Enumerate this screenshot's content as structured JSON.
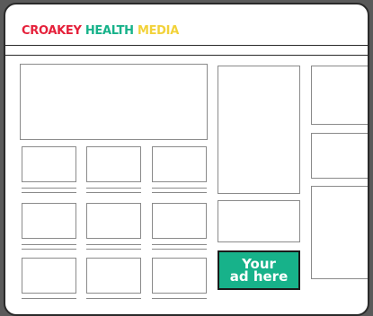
{
  "brand": {
    "part1": "CROAKEY",
    "part2": "HEALTH",
    "part3": "MEDIA",
    "colors": {
      "red": "#e5213b",
      "teal": "#17b28a",
      "yellow": "#f2d23a"
    }
  },
  "ad": {
    "line1": "Your",
    "line2": "ad here",
    "background": "#17b28a"
  }
}
